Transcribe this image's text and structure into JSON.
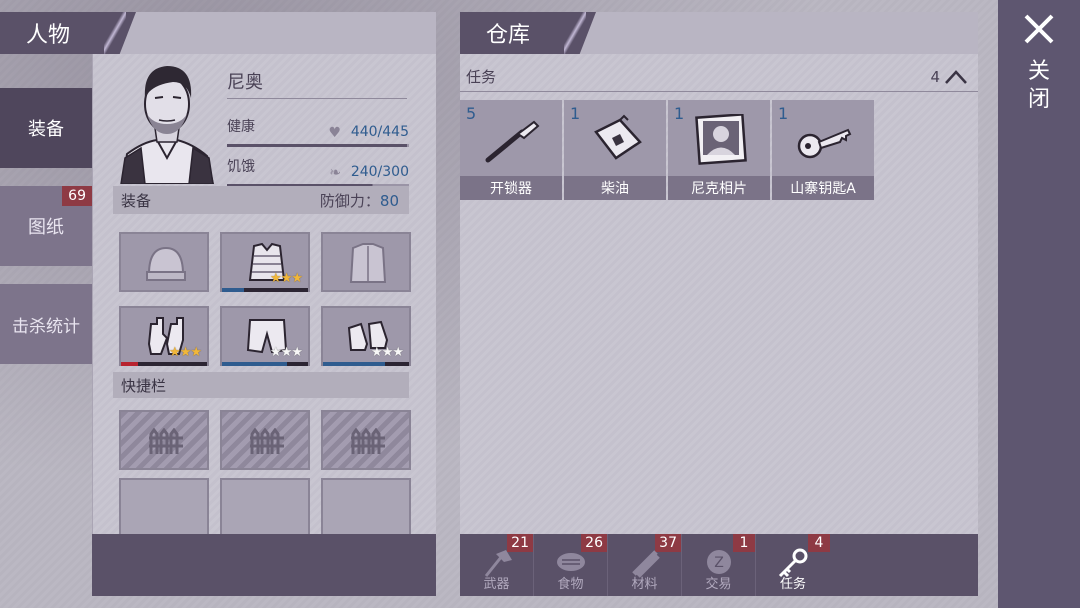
{
  "left": {
    "header_title": "人物",
    "side_tabs": [
      {
        "label": "装备",
        "badge": ""
      },
      {
        "label": "图纸",
        "badge": "69"
      },
      {
        "label": "击杀统计",
        "badge": ""
      }
    ],
    "character": {
      "name": "尼奥",
      "health_label": "健康",
      "health_value": "440/445",
      "health_fraction": 0.989,
      "hunger_label": "饥饿",
      "hunger_value": "240/300",
      "hunger_fraction": 0.8
    },
    "equipment": {
      "label": "装备",
      "defense_label": "防御力：",
      "defense_value": "80",
      "slots": [
        {
          "icon": "beanie-icon",
          "stars": 0,
          "star_color": "",
          "durability": 0,
          "dur_color": ""
        },
        {
          "icon": "vest-icon",
          "stars": 3,
          "star_color": "gold",
          "durability": 0.25,
          "dur_color": "#2f5c8f"
        },
        {
          "icon": "jacket-icon",
          "stars": 0,
          "star_color": "",
          "durability": 0,
          "dur_color": ""
        },
        {
          "icon": "gloves-icon",
          "stars": 3,
          "star_color": "gold",
          "durability": 0.2,
          "dur_color": "#b8232f"
        },
        {
          "icon": "shorts-icon",
          "stars": 3,
          "star_color": "white",
          "durability": 0.75,
          "dur_color": "#2f5c8f"
        },
        {
          "icon": "shoes-icon",
          "stars": 3,
          "star_color": "white",
          "durability": 0.72,
          "dur_color": "#2f5c8f"
        }
      ]
    },
    "quickbar": {
      "label": "快捷栏",
      "slots": [
        {
          "locked": true
        },
        {
          "locked": true
        },
        {
          "locked": true
        },
        {
          "locked": false
        },
        {
          "locked": false
        },
        {
          "locked": false
        }
      ]
    }
  },
  "warehouse": {
    "header_title": "仓库",
    "section_label": "任务",
    "section_count": "4",
    "items": [
      {
        "qty": "5",
        "name": "开锁器",
        "icon": "lockpick-icon"
      },
      {
        "qty": "1",
        "name": "柴油",
        "icon": "fuel-canister-icon"
      },
      {
        "qty": "1",
        "name": "尼克相片",
        "icon": "photo-icon"
      },
      {
        "qty": "1",
        "name": "山寨钥匙A",
        "icon": "key-icon"
      }
    ],
    "categories": [
      {
        "label": "武器",
        "badge": "21",
        "icon": "axe-icon",
        "active": false
      },
      {
        "label": "食物",
        "badge": "26",
        "icon": "meat-icon",
        "active": false
      },
      {
        "label": "材料",
        "badge": "37",
        "icon": "material-icon",
        "active": false
      },
      {
        "label": "交易",
        "badge": "1",
        "icon": "coin-icon",
        "active": false
      },
      {
        "label": "任务",
        "badge": "4",
        "icon": "key-icon",
        "active": true
      }
    ]
  },
  "close": {
    "label": "关闭",
    "icon": "close-icon"
  },
  "colors": {
    "accent_blue": "#2f5c8f",
    "badge_red": "#8e3a44",
    "panel_dark": "#5a5168"
  }
}
